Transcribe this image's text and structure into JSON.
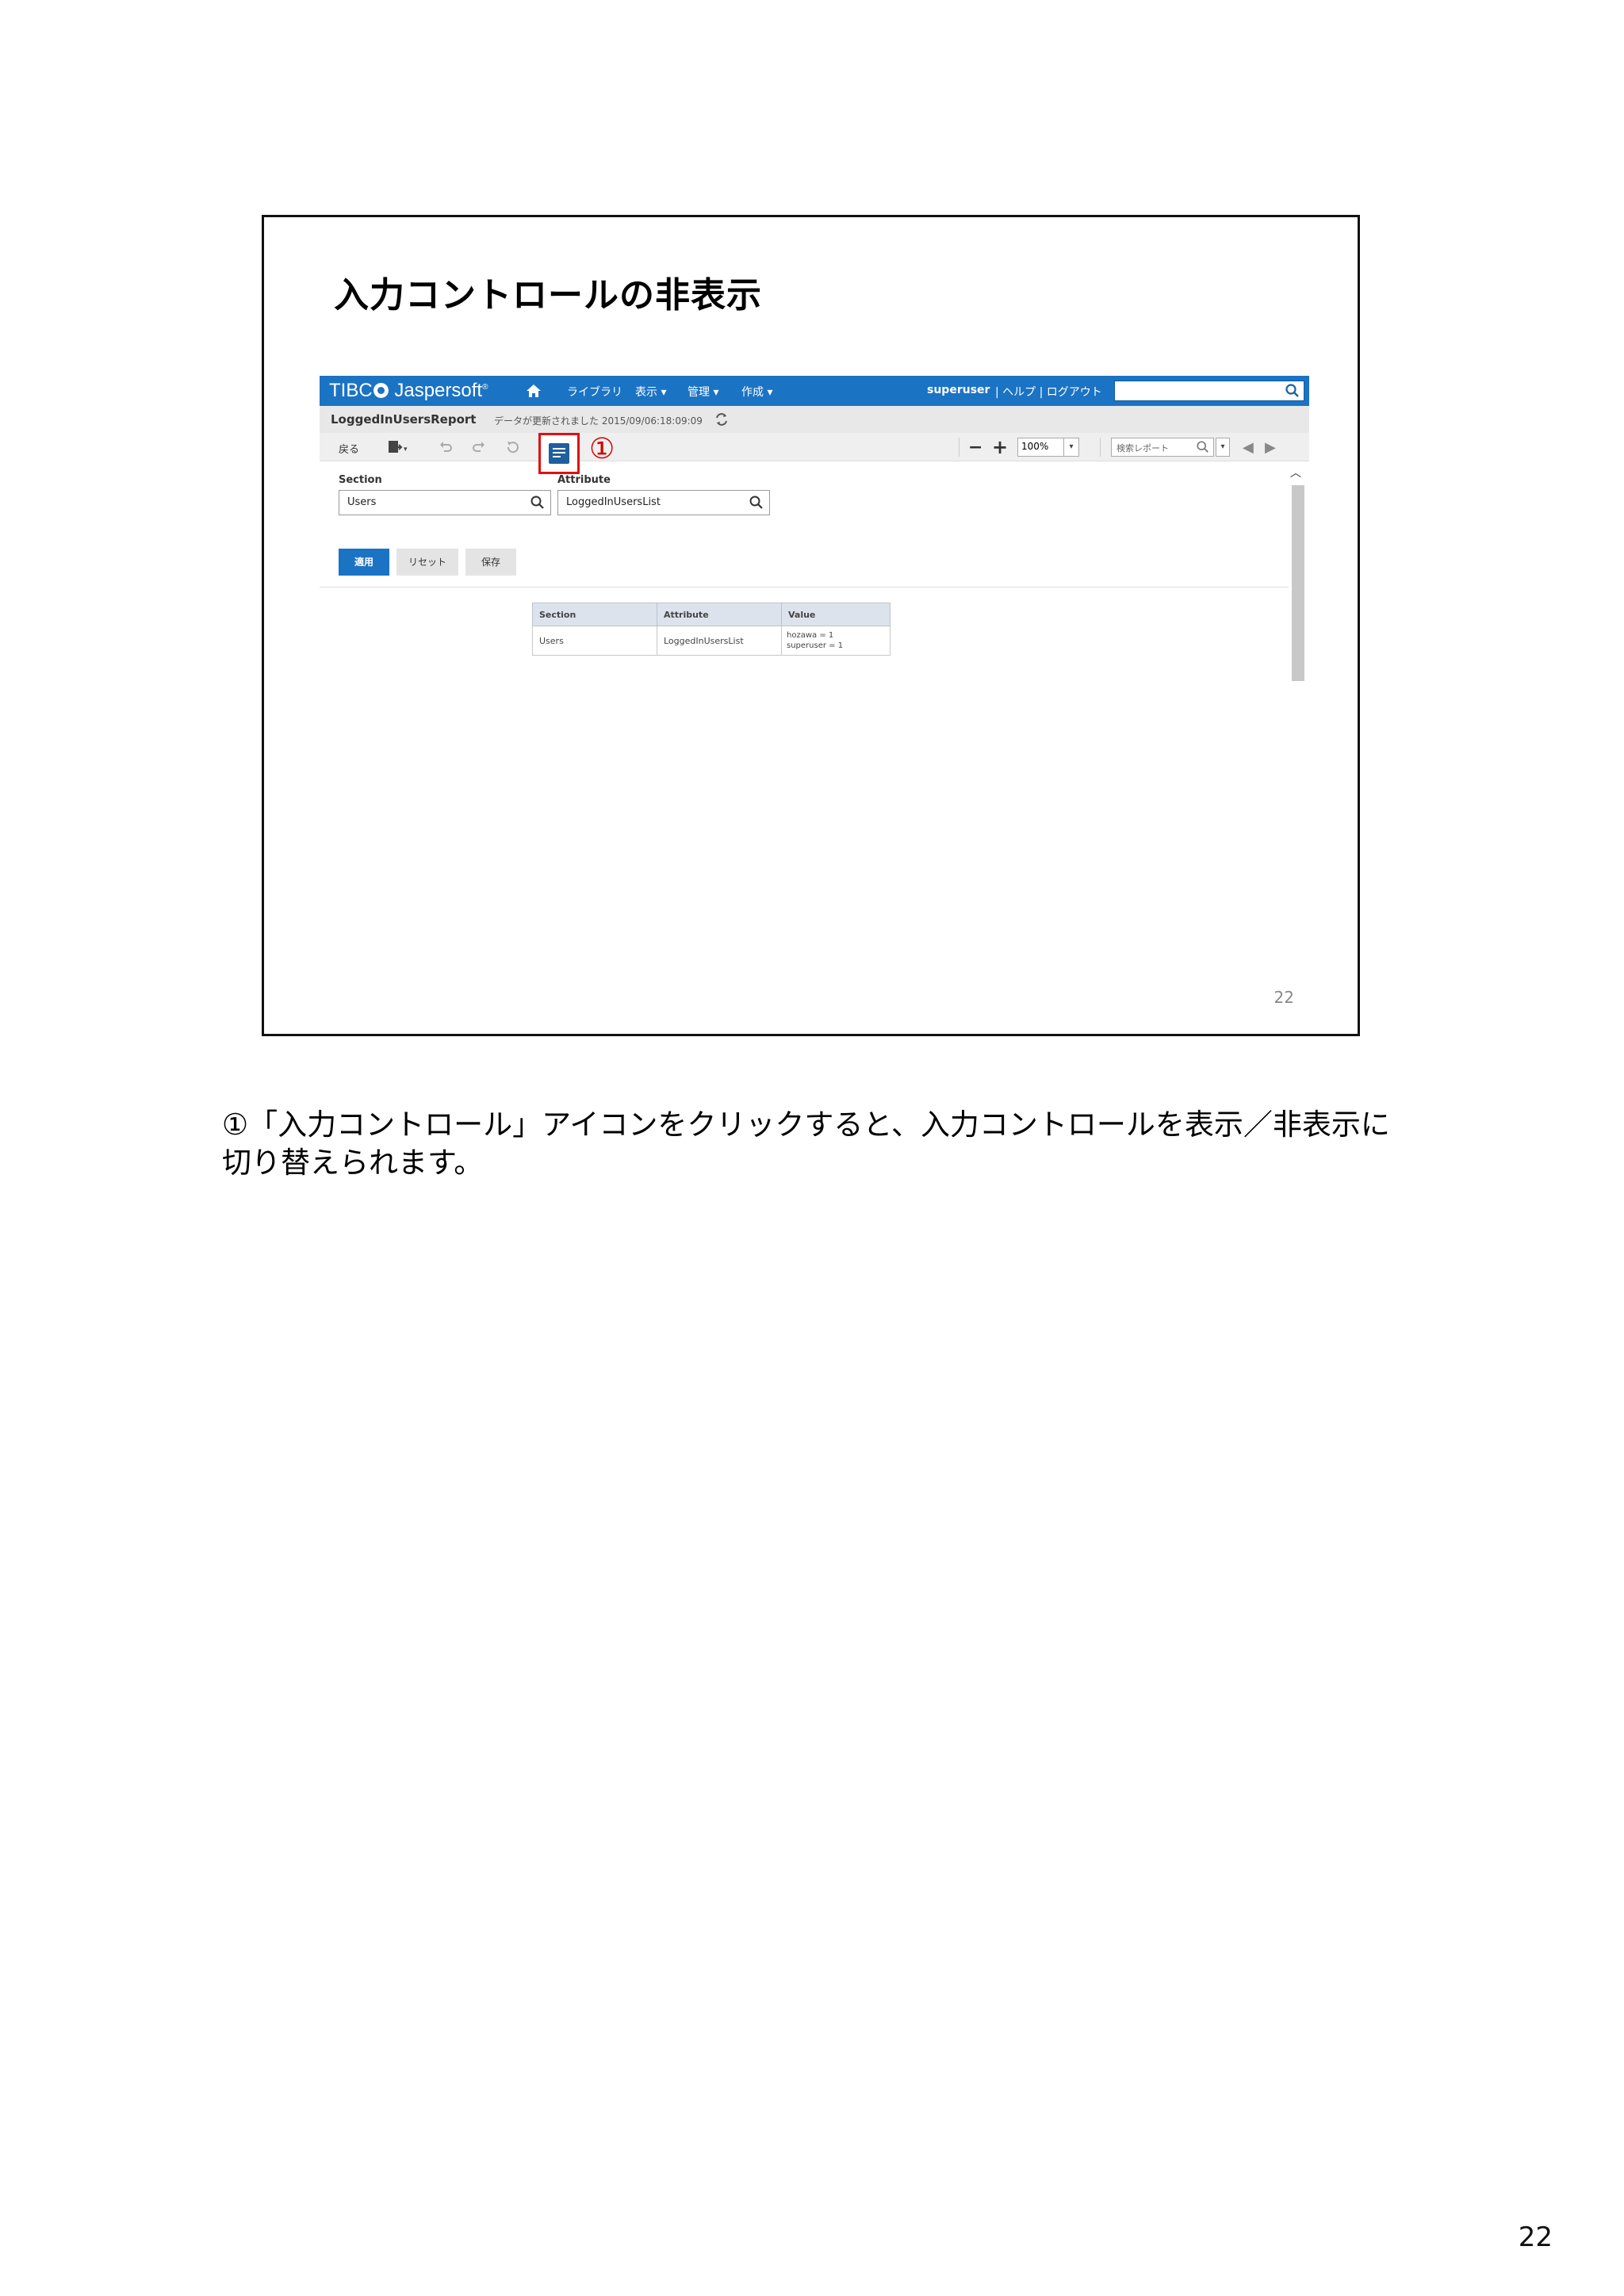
{
  "slide": {
    "title": "入力コントロールの非表示",
    "page_number": "22"
  },
  "app": {
    "logo_pre": "TIBC",
    "logo_post": " Jaspersoft",
    "logo_tm": "®",
    "nav": {
      "library": "ライブラリ",
      "view": "表示 ▾",
      "manage": "管理 ▾",
      "create": "作成 ▾"
    },
    "user": "superuser",
    "links": "| ヘルプ | ログアウト",
    "report_name": "LoggedInUsersReport",
    "updated": "データが更新されました 2015/09/06:18:09:09",
    "toolbar": {
      "back": "戻る",
      "annotation": "①",
      "zoom": "100%",
      "search_placeholder": "検索レポート"
    },
    "input_controls": {
      "section_label": "Section",
      "section_value": "Users",
      "attribute_label": "Attribute",
      "attribute_value": "LoggedInUsersList",
      "apply": "適用",
      "reset": "リセット",
      "save": "保存"
    },
    "table": {
      "headers": [
        "Section",
        "Attribute",
        "Value"
      ],
      "row": {
        "section": "Users",
        "attribute": "LoggedInUsersList",
        "value_line1": "hozawa = 1",
        "value_line2": "superuser = 1"
      }
    }
  },
  "caption": "①「入力コントロール」アイコンをクリックすると、入力コントロールを表示／非表示に切り替えられます。",
  "page_number": "22",
  "colors": {
    "topbar": "#1b73c4",
    "highlight": "#e01010"
  }
}
